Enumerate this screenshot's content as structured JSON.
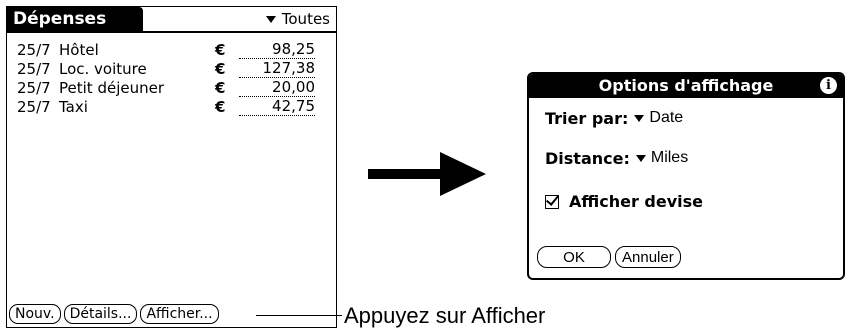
{
  "list_screen": {
    "title": "Dépenses",
    "category": "Toutes",
    "rows": [
      {
        "date": "25/7",
        "desc": "Hôtel",
        "currency": "€",
        "amount": "98,25"
      },
      {
        "date": "25/7",
        "desc": "Loc. voiture",
        "currency": "€",
        "amount": "127,38"
      },
      {
        "date": "25/7",
        "desc": "Petit déjeuner",
        "currency": "€",
        "amount": "20,00"
      },
      {
        "date": "25/7",
        "desc": "Taxi",
        "currency": "€",
        "amount": "42,75"
      }
    ],
    "buttons": {
      "new": "Nouv.",
      "details": "Détails...",
      "show": "Afficher..."
    }
  },
  "callout": "Appuyez sur Afficher",
  "dialog": {
    "title": "Options d'affichage",
    "sort_label": "Trier par:",
    "sort_value": "Date",
    "distance_label": "Distance:",
    "distance_value": "Miles",
    "show_currency_label": "Afficher devise",
    "show_currency_checked": true,
    "ok": "OK",
    "cancel": "Annuler"
  }
}
